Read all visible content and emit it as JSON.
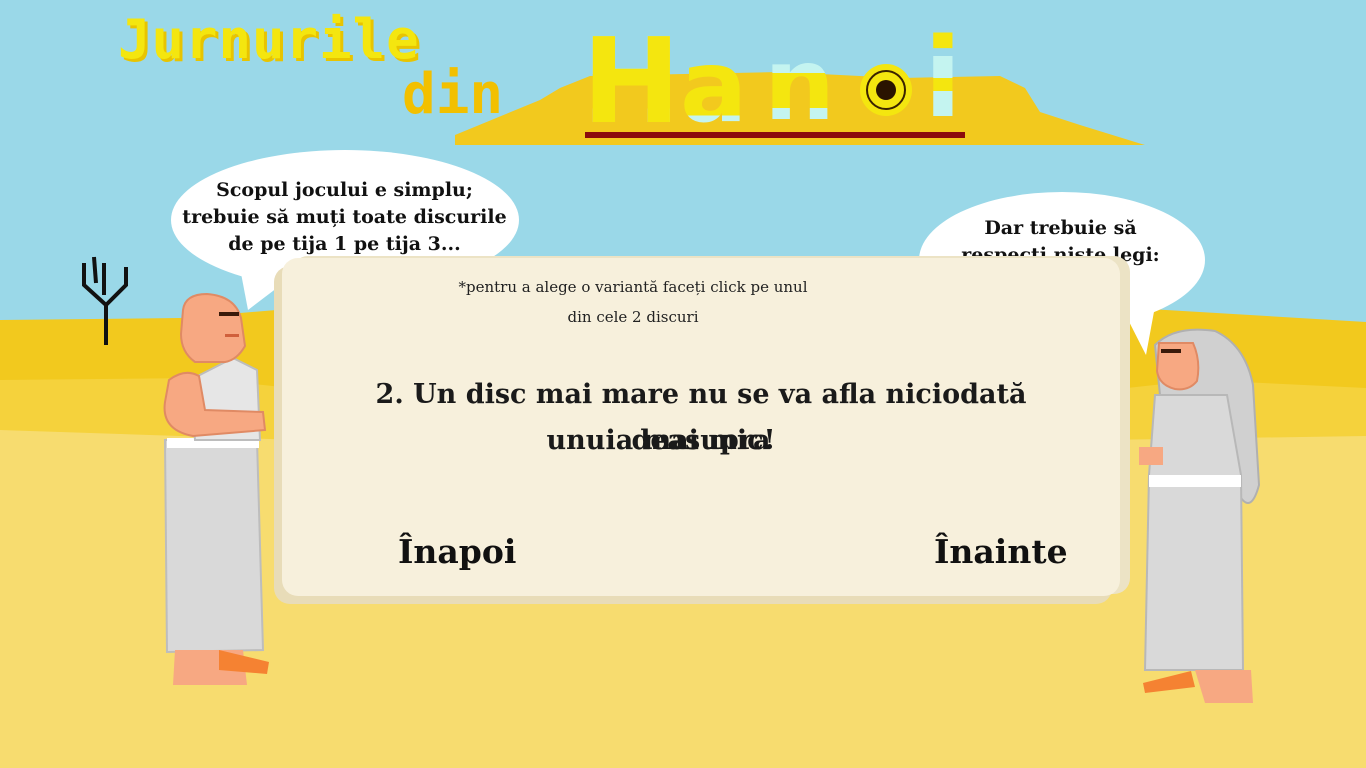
{
  "title": {
    "line1": "Jurnurile",
    "line2": "din",
    "line3_letters": [
      "H",
      "a",
      "n",
      "i"
    ]
  },
  "bubble_left": {
    "text": "Scopul jocului e simplu;\ntrebuie să muți toate discurile\nde pe tija 1 pe tija 3..."
  },
  "bubble_right": {
    "text": "Dar trebuie să\nrespecți niște legi:"
  },
  "panel": {
    "hint_line1": "*pentru a alege o variantă faceți click pe unul",
    "hint_line2": "din cele 2 discuri",
    "rule_line1": "2. Un disc mai mare nu se va afla niciodată deasupra",
    "rule_line2": "unuia mai mic!",
    "back_label": "Înapoi",
    "next_label": "Înainte"
  },
  "colors": {
    "sky": "#9ad8e8",
    "sand_light": "#f7dc6f",
    "sand_dark": "#f2c91e",
    "title_yellow": "#f4e60f",
    "underline": "#8b0c0c",
    "skin": "#f7a882",
    "robe": "#d9d9d9",
    "shoe": "#f58232"
  }
}
